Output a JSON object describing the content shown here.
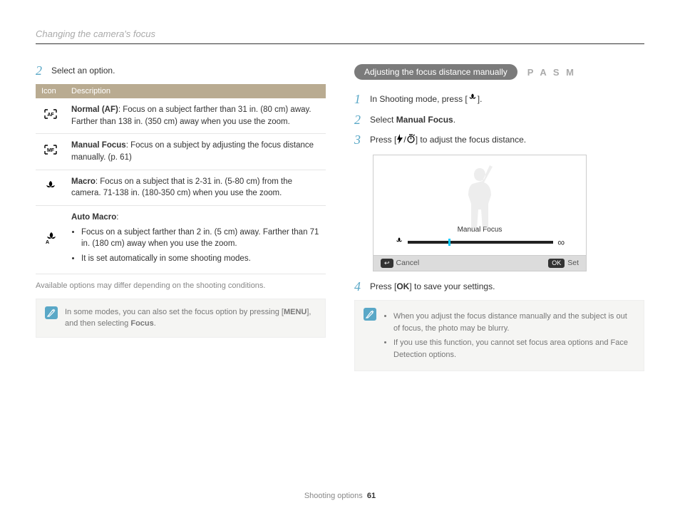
{
  "header": {
    "title": "Changing the camera's focus"
  },
  "left": {
    "step2_num": "2",
    "step2_text": "Select an option.",
    "table": {
      "col_icon": "Icon",
      "col_desc": "Description",
      "normal_b": "Normal (AF)",
      "normal_t": ": Focus on a subject farther than 31 in. (80 cm) away. Farther than 138 in. (350 cm) away when you use the zoom.",
      "manual_b": "Manual Focus",
      "manual_t": ": Focus on a subject by adjusting the focus distance manually. (p. 61)",
      "macro_b": "Macro",
      "macro_t": ": Focus on a subject that is 2-31 in. (5-80 cm) from the camera. 71-138 in. (180-350 cm) when you use the zoom.",
      "auto_b": "Auto Macro",
      "auto_t": ":",
      "auto_li1": "Focus on a subject farther than 2 in. (5 cm) away. Farther than 71 in. (180 cm) away when you use the zoom.",
      "auto_li2": "It is set automatically in some shooting modes."
    },
    "caption": "Available options may differ depending on the shooting conditions.",
    "note_pre": "In some modes, you can also set the focus option by pressing [",
    "note_menu": "MENU",
    "note_mid": "], and then selecting ",
    "note_focus": "Focus",
    "note_post": "."
  },
  "right": {
    "pill": "Adjusting the focus distance manually",
    "modes": "P A S M",
    "s1n": "1",
    "s1_pre": "In Shooting mode, press [",
    "s1_post": "].",
    "s2n": "2",
    "s2_pre": "Select ",
    "s2_b": "Manual Focus",
    "s2_post": ".",
    "s3n": "3",
    "s3_pre": "Press [",
    "s3_mid": "/",
    "s3_post": "] to adjust the focus distance.",
    "display_label": "Manual Focus",
    "cancel": "Cancel",
    "set": "Set",
    "s4n": "4",
    "s4_pre": "Press [",
    "s4_ok": "OK",
    "s4_post": "] to save your settings.",
    "note_li1": "When you adjust the focus distance manually and the subject is out of focus, the photo may be blurry.",
    "note_li2": "If you use this function, you cannot set focus area options and Face Detection options."
  },
  "footer": {
    "section": "Shooting options",
    "page": "61"
  }
}
